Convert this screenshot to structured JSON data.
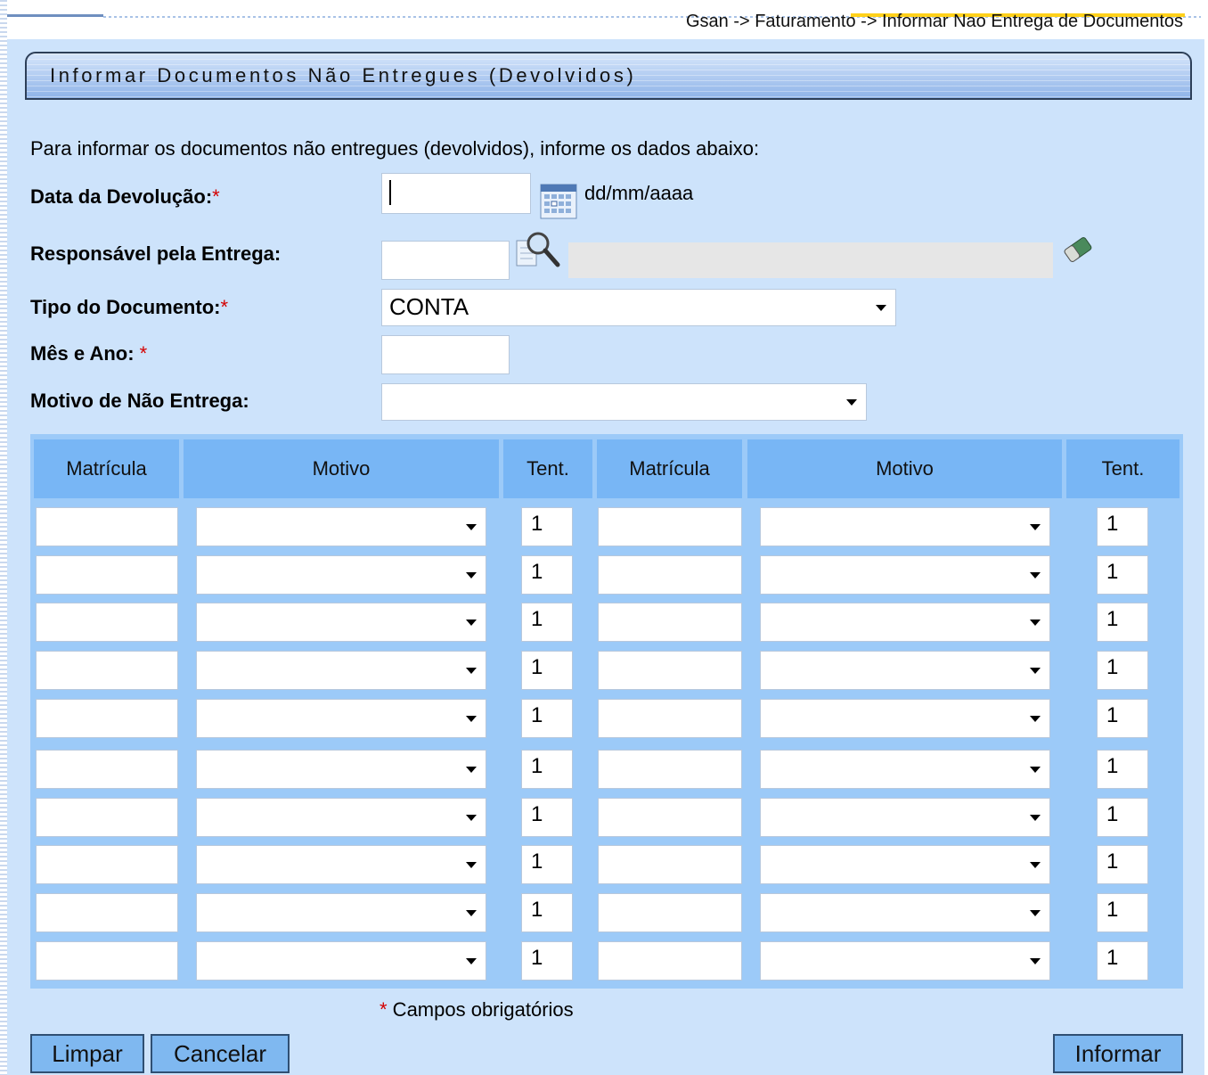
{
  "breadcrumb": "Gsan -> Faturamento -> Informar Nao Entrega de Documentos",
  "panel_title": "Informar Documentos Não Entregues (Devolvidos)",
  "intro": "Para informar os documentos não entregues (devolvidos), informe os dados abaixo:",
  "fields": {
    "data_devolucao": {
      "label": "Data da Devolução:",
      "required_mark": "*",
      "value": "",
      "hint": "dd/mm/aaaa"
    },
    "responsavel": {
      "label": "Responsável pela Entrega:",
      "value": "",
      "description": ""
    },
    "tipo_documento": {
      "label": "Tipo do Documento:",
      "required_mark": "*",
      "value": "CONTA"
    },
    "mes_ano": {
      "label": "Mês e Ano:",
      "required_mark": "*",
      "value": ""
    },
    "motivo": {
      "label": "Motivo de Não Entrega:",
      "value": ""
    }
  },
  "table": {
    "headers": [
      "Matrícula",
      "Motivo",
      "Tent.",
      "Matrícula",
      "Motivo",
      "Tent."
    ],
    "rows": [
      {
        "left": {
          "matricula": "",
          "motivo": "",
          "tent": "1"
        },
        "right": {
          "matricula": "",
          "motivo": "",
          "tent": "1"
        }
      },
      {
        "left": {
          "matricula": "",
          "motivo": "",
          "tent": "1"
        },
        "right": {
          "matricula": "",
          "motivo": "",
          "tent": "1"
        }
      },
      {
        "left": {
          "matricula": "",
          "motivo": "",
          "tent": "1"
        },
        "right": {
          "matricula": "",
          "motivo": "",
          "tent": "1"
        }
      },
      {
        "left": {
          "matricula": "",
          "motivo": "",
          "tent": "1"
        },
        "right": {
          "matricula": "",
          "motivo": "",
          "tent": "1"
        }
      },
      {
        "left": {
          "matricula": "",
          "motivo": "",
          "tent": "1"
        },
        "right": {
          "matricula": "",
          "motivo": "",
          "tent": "1"
        }
      },
      {
        "left": {
          "matricula": "",
          "motivo": "",
          "tent": "1"
        },
        "right": {
          "matricula": "",
          "motivo": "",
          "tent": "1"
        }
      },
      {
        "left": {
          "matricula": "",
          "motivo": "",
          "tent": "1"
        },
        "right": {
          "matricula": "",
          "motivo": "",
          "tent": "1"
        }
      },
      {
        "left": {
          "matricula": "",
          "motivo": "",
          "tent": "1"
        },
        "right": {
          "matricula": "",
          "motivo": "",
          "tent": "1"
        }
      },
      {
        "left": {
          "matricula": "",
          "motivo": "",
          "tent": "1"
        },
        "right": {
          "matricula": "",
          "motivo": "",
          "tent": "1"
        }
      },
      {
        "left": {
          "matricula": "",
          "motivo": "",
          "tent": "1"
        },
        "right": {
          "matricula": "",
          "motivo": "",
          "tent": "1"
        }
      }
    ]
  },
  "required_note": {
    "mark": "*",
    "text": " Campos obrigatórios"
  },
  "buttons": {
    "limpar": "Limpar",
    "cancelar": "Cancelar",
    "informar": "Informar"
  },
  "icons": {
    "calendar": "calendar-icon",
    "search": "search-icon",
    "eraser": "eraser-icon"
  },
  "colors": {
    "panel_bg": "#cde3fb",
    "table_header": "#78b6f5",
    "table_bg": "#9ccaf8",
    "required": "#d40000",
    "button": "#7fb8f0"
  }
}
